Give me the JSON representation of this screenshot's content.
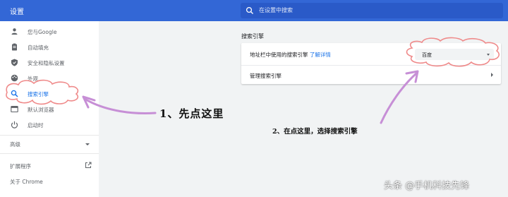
{
  "header": {
    "title": "设置",
    "search_placeholder": "在设置中搜索"
  },
  "sidebar": {
    "items": [
      {
        "label": "您与Google",
        "icon": "person-icon"
      },
      {
        "label": "自动填充",
        "icon": "clipboard-icon"
      },
      {
        "label": "安全和隐私设置",
        "icon": "shield-icon"
      },
      {
        "label": "外观",
        "icon": "palette-icon"
      },
      {
        "label": "搜索引擎",
        "icon": "search-icon",
        "active": true
      },
      {
        "label": "默认浏览器",
        "icon": "browser-icon"
      },
      {
        "label": "启动时",
        "icon": "power-icon"
      }
    ],
    "advanced_label": "高级",
    "extensions_label": "扩展程序",
    "about_label": "关于 Chrome"
  },
  "main": {
    "section_title": "搜索引擎",
    "address_bar_label": "地址栏中使用的搜索引擎",
    "learn_more_link": "了解详情",
    "engine_select_value": "百度",
    "manage_label": "管理搜索引擎"
  },
  "annotations": {
    "step1": "1、先点这里",
    "step2": "2、在点这里，选择搜索引擎"
  },
  "watermark": "头条 @手机科技先锋",
  "colors": {
    "header_blue": "#3367d6",
    "accent_blue": "#1a73e8",
    "cloud_stroke": "#ef8a8a",
    "arrow_purple": "#c78fd6"
  }
}
